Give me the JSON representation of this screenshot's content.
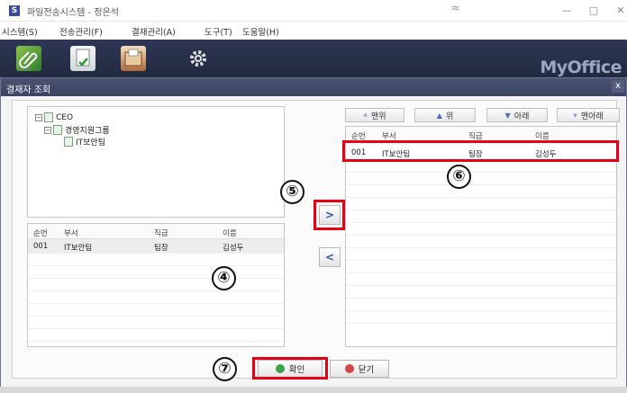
{
  "window": {
    "app_icon": "S",
    "title": "파일전송시스템 - 정은석",
    "title_glyph": "≈",
    "minimize": "—",
    "maximize": "□",
    "close": "✕"
  },
  "menu": [
    "시스템(S)",
    "전송관리(F)",
    "결재관리(A)",
    "도구(T)",
    "도움말(H)"
  ],
  "toolbar": {
    "icons": [
      "paperclip-icon",
      "document-check-icon",
      "mail-folder-icon",
      "gear-icon"
    ],
    "brand": "MyOffice"
  },
  "dialog": {
    "title": "결재자 조회",
    "close": "x"
  },
  "tree": {
    "nodes": [
      {
        "toggle": "−",
        "label": "CEO"
      },
      {
        "toggle": "−",
        "label": "경영지원그룹"
      },
      {
        "toggle": "",
        "label": "IT보안팀"
      }
    ]
  },
  "grid_headers": {
    "num": "순번",
    "dept": "부서",
    "rank": "직급",
    "name": "이름"
  },
  "left_grid": {
    "rows": [
      {
        "num": "001",
        "dept": "IT보안팀",
        "rank": "팀장",
        "name": "김성두"
      }
    ]
  },
  "right_grid": {
    "rows": [
      {
        "num": "001",
        "dept": "IT보안팀",
        "rank": "팀장",
        "name": "김성두"
      }
    ]
  },
  "order_buttons": {
    "top": {
      "arrow": "⩚",
      "label": "맨위"
    },
    "up": {
      "arrow": "▲",
      "label": "위"
    },
    "down": {
      "arrow": "▼",
      "label": "아래"
    },
    "bottom": {
      "arrow": "⩛",
      "label": "맨아래"
    }
  },
  "transfer": {
    "add": ">",
    "remove": "<"
  },
  "buttons": {
    "ok": "확인",
    "close": "닫기"
  },
  "callouts": [
    "④",
    "⑤",
    "⑥",
    "⑦"
  ],
  "colors": {
    "highlight": "#e60012",
    "titlebar": "#3b4462",
    "toolbar": "#222a40"
  }
}
